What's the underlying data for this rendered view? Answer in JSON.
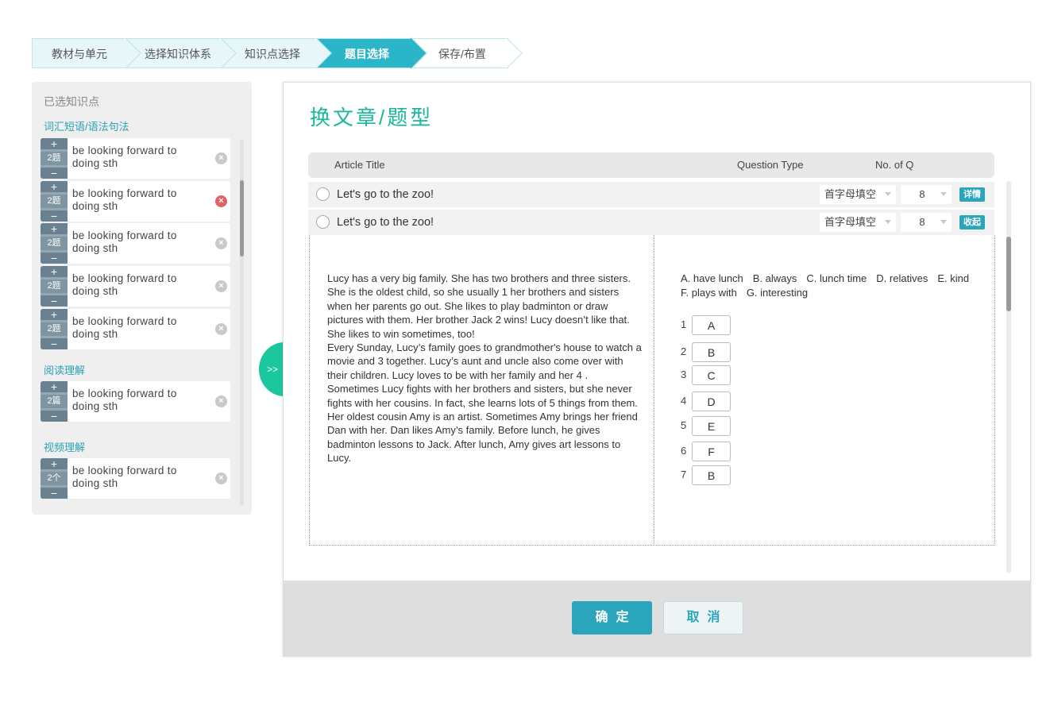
{
  "steps": [
    "教材与单元",
    "选择知识体系",
    "知识点选择",
    "题目选择",
    "保存/布置"
  ],
  "left_panel": {
    "header": "已选知识点",
    "categories": [
      {
        "title": "词汇短语/语法句法"
      },
      {
        "title": "阅读理解"
      },
      {
        "title": "视频理解"
      }
    ],
    "items": [
      {
        "count": "2题",
        "label": "be looking forward to doing sth"
      },
      {
        "count": "2题",
        "label": "be looking forward to doing sth"
      },
      {
        "count": "2题",
        "label": "be looking forward to doing sth"
      },
      {
        "count": "2题",
        "label": "be looking forward to doing sth"
      },
      {
        "count": "2题",
        "label": "be looking forward to doing sth"
      },
      {
        "count": "2篇",
        "label": "be looking forward to doing sth"
      },
      {
        "count": "2个",
        "label": "be looking forward to doing sth"
      }
    ],
    "plus": "+",
    "minus": "−",
    "remove": "×",
    "expand_label": ">>"
  },
  "dialog": {
    "title": "换文章/题型",
    "columns": {
      "article": "Article Title",
      "type": "Question Type",
      "count": "No. of Q"
    },
    "rows": [
      {
        "title": "Let's go to the zoo!",
        "type": "首字母填空",
        "count": "8",
        "action": "详情"
      },
      {
        "title": "Let's go to the zoo!",
        "type": "首字母填空",
        "count": "8",
        "action": "收起"
      }
    ],
    "article_text": "Lucy has a very big family. She has two brothers and three sisters. She is the oldest child, so she usually  1  her brothers and sisters when her parents go out. She likes to play badminton or draw pictures with them. Her brother Jack  2  wins! Lucy doesn’t like that. She likes to win sometimes, too!\nEvery Sunday, Lucy’s family goes to grandmother's house to watch a movie and  3  together. Lucy’s aunt and uncle also come over with their children. Lucy loves to be with her family and her  4 .\nSometimes Lucy fights with her brothers and sisters, but she never fights with her cousins. In fact, she learns lots of  5  things from them. Her oldest cousin Amy is an artist. Sometimes Amy brings her friend Dan with her. Dan likes Amy’s family. Before lunch, he gives badminton lessons to Jack. After lunch, Amy gives art lessons to Lucy.",
    "options": [
      "A. have lunch",
      "B. always",
      "C. lunch time",
      "D. relatives",
      "E. kind",
      "F. plays with",
      "G. interesting"
    ],
    "answers": [
      {
        "n": "1",
        "v": "A"
      },
      {
        "n": "2",
        "v": "B"
      },
      {
        "n": "3",
        "v": "C"
      },
      {
        "n": "4",
        "v": "D"
      },
      {
        "n": "5",
        "v": "E"
      },
      {
        "n": "6",
        "v": "F"
      },
      {
        "n": "7",
        "v": "B"
      }
    ],
    "ok": "确定",
    "cancel": "取消"
  },
  "colors": {
    "accent": "#2aa5bb",
    "title_green": "#1ab89a",
    "expand_green": "#1cc79d",
    "remove_active": "#e06464"
  }
}
